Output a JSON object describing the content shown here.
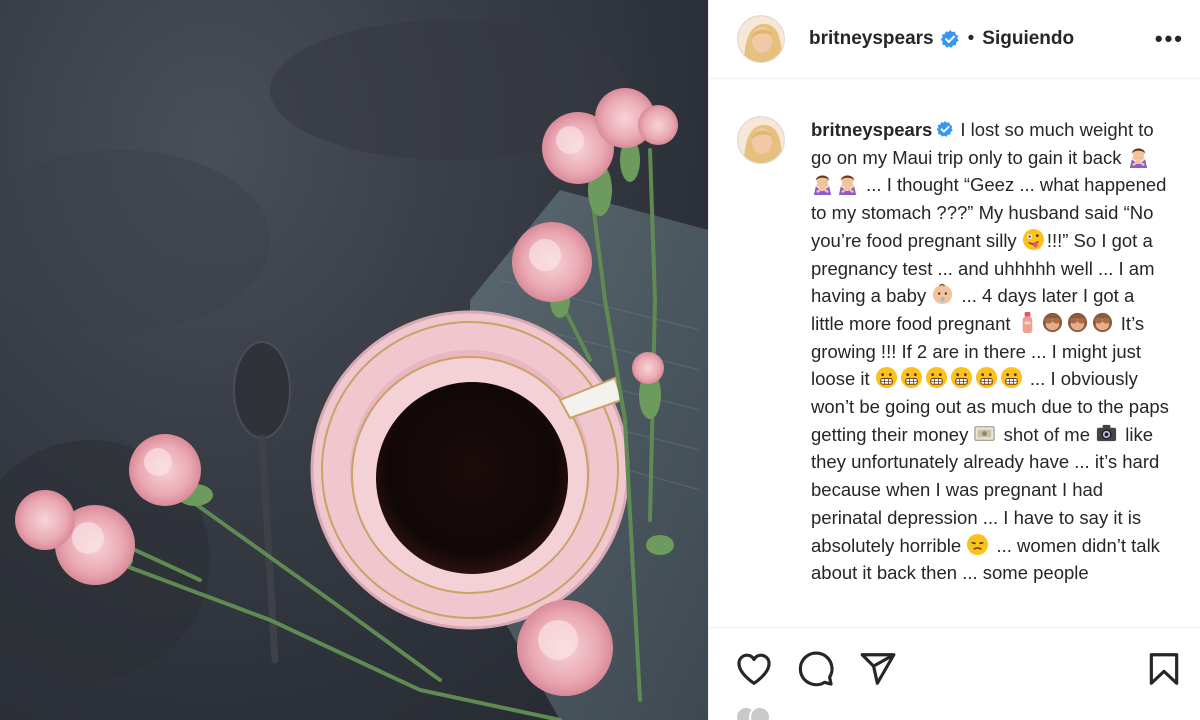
{
  "post": {
    "username": "britneyspears",
    "follow_status": "Siguiendo",
    "separator": "•",
    "more_label": "•••"
  },
  "caption": {
    "username": "britneyspears",
    "segments": [
      "I lost so much weight to go on my Maui trip only to gain it back",
      "... I thought “Geez ... what happened to my stomach ???” My husband said “No you’re food pregnant silly",
      "!!!” So I got a pregnancy test ... and uhhhhh well ... I am having a baby",
      "... 4 days later I got a little more food pregnant",
      "It’s growing !!! If 2 are in there ... I might just loose it",
      "... I obviously won’t be going out as much due to the paps getting their money",
      "shot of me",
      "like they unfortunately already have ... it’s hard because when I was pregnant I had perinatal depression ... I have to say it is absolutely horrible",
      "... women didn’t talk about it back then ... some people"
    ],
    "emojis": {
      "group1": [
        "woman-gesturing-no-emoji",
        "woman-gesturing-no-emoji",
        "woman-gesturing-no-emoji"
      ],
      "group2": [
        "zany-face-emoji"
      ],
      "group3": [
        "baby-emoji"
      ],
      "group4": [
        "bottle-emoji",
        "see-no-evil-monkey-emoji",
        "see-no-evil-monkey-emoji",
        "see-no-evil-monkey-emoji"
      ],
      "group5": [
        "grimacing-face-emoji",
        "grimacing-face-emoji",
        "grimacing-face-emoji",
        "grimacing-face-emoji",
        "grimacing-face-emoji",
        "grimacing-face-emoji"
      ],
      "group6": [
        "money-bill-emoji"
      ],
      "group7": [
        "camera-emoji"
      ],
      "group8": [
        "disappointed-face-emoji"
      ]
    }
  },
  "actions": {
    "icons": [
      "heart-icon",
      "comment-icon",
      "share-icon",
      "bookmark-icon"
    ]
  },
  "colors": {
    "verified": "#3897f0",
    "text": "#262626",
    "border": "#efefef"
  }
}
